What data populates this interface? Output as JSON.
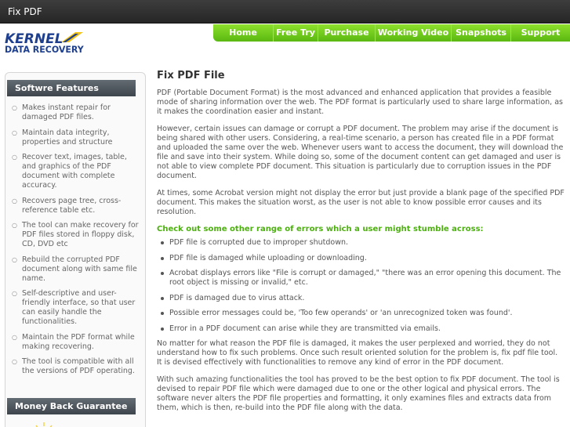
{
  "header": {
    "title": "Fix PDF"
  },
  "logo": {
    "brand_top": "KERNEL",
    "brand_bottom": "DATA RECOVERY"
  },
  "nav": {
    "items": [
      "Home",
      "Free Try",
      "Purchase",
      "Working Video",
      "Snapshots",
      "Support"
    ]
  },
  "sidebar": {
    "features_heading": "Softwre Features",
    "features": [
      "Makes instant repair for damaged PDF files.",
      "Maintain data integrity, properties and structure",
      "Recover text, images, table, and graphics of the PDF document with complete accuracy.",
      "Recovers page tree, cross-reference table etc.",
      "The tool can make recovery for PDF files stored in floppy disk, CD, DVD etc",
      "Rebuild the corrupted PDF document along with same file name.",
      "Self-descriptive and user-friendly interface, so that user can easily handle the functionalities.",
      "Maintain the PDF format while making recovering.",
      "The tool is compatible with all the versions of PDF operating."
    ],
    "guarantee_heading": "Money Back Guarantee"
  },
  "main": {
    "title": "Fix PDF File",
    "intro": [
      "PDF (Portable Document Format) is the most advanced and enhanced application that provides a feasible mode of sharing information over the web. The PDF format is particularly used to share large information, as it makes the coordination easier and instant.",
      "However, certain issues can damage or corrupt a PDF document. The problem may arise if the document is being shared with other users. Considering, a real-time scenario, a person has created file in a PDF format and uploaded the same over the web. Whenever users want to access the document, they will download the file and save into their system. While doing so, some of the document content can get damaged and user is not able to view complete PDF document. This situation is particularly due to corruption issues in the PDF document.",
      "At times, some Acrobat version might not display the error but just provide a blank page of the specified PDF document. This makes the situation worst, as the user is not able to know possible error causes and its resolution."
    ],
    "errors_heading": "Check out some other range of errors which a user might stumble across:",
    "errors": [
      "PDF file is corrupted due to improper shutdown.",
      "PDF file is damaged while uploading or downloading.",
      "Acrobat displays errors like \"File is corrupt or damaged,\" \"there was an error opening this document. The root object is missing or invalid,\" etc.",
      "PDF is damaged due to virus attack.",
      "Possible error messages could be, 'Too few operands' or 'an unrecognized token was found'.",
      "Error in a PDF document can arise while they are transmitted via emails."
    ],
    "outro": [
      "No matter for what reason the PDF file is damaged, it makes the user perplexed and worried, they do not understand how to fix such problems. Once such result oriented solution for the problem is, fix pdf file tool. It is devised effectively with functionalities to remove any kind of error in the PDF document.",
      "With such amazing functionalities the tool has proved to be the best option to fix PDF document. The tool is devised to repair PDF file which were damaged due to one or the other logical and physical errors. The software never alters the PDF file properties and formatting, it only examines files and extracts data from them, which is then, re-build into the PDF file along with the data."
    ]
  },
  "colors": {
    "nav_green": "#5ab811",
    "heading_green": "#4cb00f",
    "brand_blue": "#1e3f8e"
  }
}
